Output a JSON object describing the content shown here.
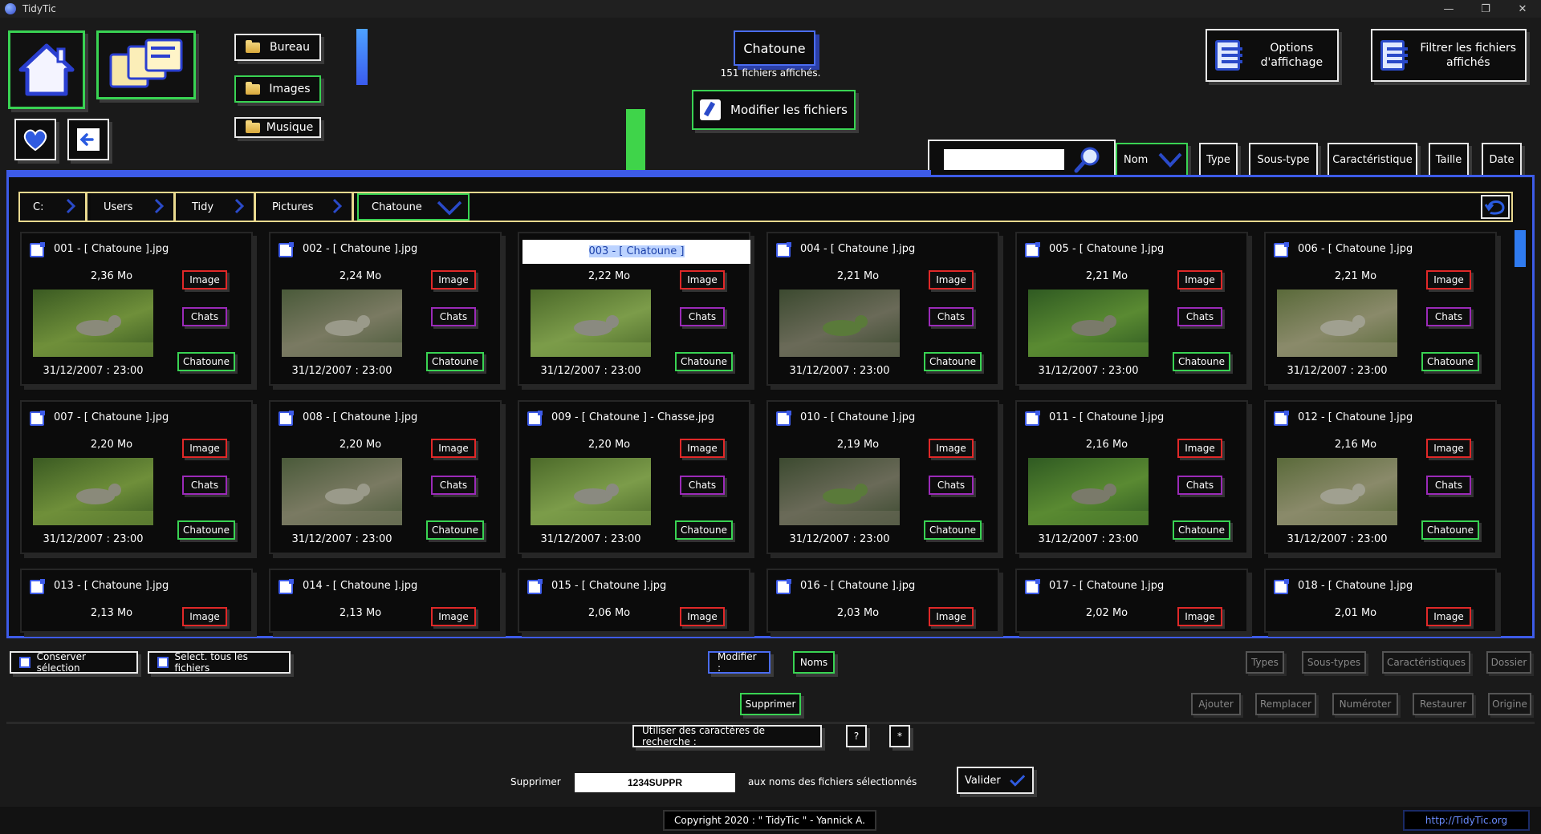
{
  "window": {
    "title": "TidyTic",
    "controls": [
      "—",
      "❐",
      "✕"
    ]
  },
  "shortcuts": [
    {
      "name": "desktop",
      "label": "Bureau"
    },
    {
      "name": "images",
      "label": "Images"
    },
    {
      "name": "music",
      "label": "Musique"
    }
  ],
  "current": {
    "folder": "Chatoune",
    "count_text": "151 fichiers affichés.",
    "modify_label": "Modifier les fichiers"
  },
  "options": {
    "display": "Options d'affichage",
    "filter": "Filtrer les fichiers affichés"
  },
  "search": {
    "value": ""
  },
  "sort_tabs": [
    "Nom",
    "Type",
    "Sous-type",
    "Caractéristique",
    "Taille",
    "Date"
  ],
  "breadcrumb": [
    "C:",
    "Users",
    "Tidy",
    "Pictures",
    "Chatoune"
  ],
  "files": [
    {
      "name": "001 - [ Chatoune ].jpg",
      "size": "2,36 Mo",
      "date": "31/12/2007 : 23:00",
      "tags": [
        "Image",
        "Chats",
        "Chatoune"
      ]
    },
    {
      "name": "002 - [ Chatoune ].jpg",
      "size": "2,24 Mo",
      "date": "31/12/2007 : 23:00",
      "tags": [
        "Image",
        "Chats",
        "Chatoune"
      ]
    },
    {
      "name": "003 - [ Chatoune ]",
      "size": "2,22 Mo",
      "date": "31/12/2007 : 23:00",
      "tags": [
        "Image",
        "Chats",
        "Chatoune"
      ],
      "editing": true
    },
    {
      "name": "004 - [ Chatoune ].jpg",
      "size": "2,21 Mo",
      "date": "31/12/2007 : 23:00",
      "tags": [
        "Image",
        "Chats",
        "Chatoune"
      ]
    },
    {
      "name": "005 - [ Chatoune ].jpg",
      "size": "2,21 Mo",
      "date": "31/12/2007 : 23:00",
      "tags": [
        "Image",
        "Chats",
        "Chatoune"
      ]
    },
    {
      "name": "006 - [ Chatoune ].jpg",
      "size": "2,21 Mo",
      "date": "31/12/2007 : 23:00",
      "tags": [
        "Image",
        "Chats",
        "Chatoune"
      ]
    },
    {
      "name": "007 - [ Chatoune ].jpg",
      "size": "2,20 Mo",
      "date": "31/12/2007 : 23:00",
      "tags": [
        "Image",
        "Chats",
        "Chatoune"
      ]
    },
    {
      "name": "008 - [ Chatoune ].jpg",
      "size": "2,20 Mo",
      "date": "31/12/2007 : 23:00",
      "tags": [
        "Image",
        "Chats",
        "Chatoune"
      ]
    },
    {
      "name": "009 - [ Chatoune ] - Chasse.jpg",
      "size": "2,20 Mo",
      "date": "31/12/2007 : 23:00",
      "tags": [
        "Image",
        "Chats",
        "Chatoune"
      ]
    },
    {
      "name": "010 - [ Chatoune ].jpg",
      "size": "2,19 Mo",
      "date": "31/12/2007 : 23:00",
      "tags": [
        "Image",
        "Chats",
        "Chatoune"
      ]
    },
    {
      "name": "011 - [ Chatoune ].jpg",
      "size": "2,16 Mo",
      "date": "31/12/2007 : 23:00",
      "tags": [
        "Image",
        "Chats",
        "Chatoune"
      ]
    },
    {
      "name": "012 - [ Chatoune ].jpg",
      "size": "2,16 Mo",
      "date": "31/12/2007 : 23:00",
      "tags": [
        "Image",
        "Chats",
        "Chatoune"
      ]
    },
    {
      "name": "013 - [ Chatoune ].jpg",
      "size": "2,13 Mo",
      "date": "",
      "tags": [
        "Image"
      ]
    },
    {
      "name": "014 - [ Chatoune ].jpg",
      "size": "2,13 Mo",
      "date": "",
      "tags": [
        "Image"
      ]
    },
    {
      "name": "015 - [ Chatoune ].jpg",
      "size": "2,06 Mo",
      "date": "",
      "tags": [
        "Image"
      ]
    },
    {
      "name": "016 - [ Chatoune ].jpg",
      "size": "2,03 Mo",
      "date": "",
      "tags": [
        "Image"
      ]
    },
    {
      "name": "017 - [ Chatoune ].jpg",
      "size": "2,02 Mo",
      "date": "",
      "tags": [
        "Image"
      ]
    },
    {
      "name": "018 - [ Chatoune ].jpg",
      "size": "2,01 Mo",
      "date": "",
      "tags": [
        "Image"
      ]
    }
  ],
  "bottom": {
    "keep_selection": "Conserver sélection",
    "select_all": "Select. tous les fichiers",
    "modify": "Modifier :",
    "names": "Noms",
    "types": "Types",
    "subtypes": "Sous-types",
    "characteristics": "Caractéristiques",
    "folder": "Dossier",
    "delete": "Supprimer",
    "add": "Ajouter",
    "replace": "Remplacer",
    "number": "Numéroter",
    "restore": "Restaurer",
    "origin": "Origine",
    "wildcards": "Utiliser des caractères de recherche :",
    "wild_q": "?",
    "wild_star": "*",
    "supp_prefix": "Supprimer",
    "supp_value": "1234SUPPR",
    "supp_suffix": "aux noms des fichiers sélectionnés",
    "validate": "Valider"
  },
  "footer": {
    "copyright": "Copyright 2020 : \" TidyTic \" - Yannick A.",
    "link": "http://TidyTic.org"
  },
  "colors": {
    "accent_blue": "#3d5be8",
    "accent_green": "#39d353",
    "tag_red": "#e02828",
    "tag_purple": "#9b2ab8",
    "crumb_gold": "#e9d98f"
  }
}
